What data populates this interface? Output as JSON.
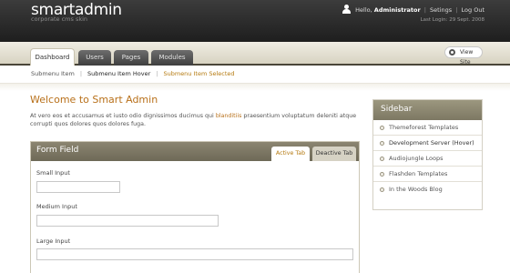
{
  "header": {
    "logo_bold": "smart",
    "logo_light": "admin",
    "tagline": "corporate cms skin",
    "greeting": "Hello,",
    "username": "Administrator",
    "settings": "Setings",
    "logout": "Log Out",
    "last_login": "Last Login: 29 Sept. 2008"
  },
  "nav": {
    "tabs": [
      "Dashboard",
      "Users",
      "Pages",
      "Modules"
    ],
    "view_site": "View Site"
  },
  "submenu": {
    "items": [
      "Submenu Item",
      "Submenu Item Hover",
      "Submenu Item Selected"
    ]
  },
  "main": {
    "welcome": "Welcome to Smart Admin",
    "intro_before": "At vero eos et accusamus et iusto odio dignissimos ducimus qui ",
    "intro_highlight": "blanditiis",
    "intro_after": " praesentium voluptatum deleniti atque corrupti quos dolores quos dolores fuga."
  },
  "form": {
    "title": "Form Field",
    "tab_active": "Active Tab",
    "tab_inactive": "Deactive Tab",
    "fields": [
      {
        "label": "Small Input",
        "value": ""
      },
      {
        "label": "Medium Input",
        "value": ""
      },
      {
        "label": "Large Input",
        "value": ""
      }
    ]
  },
  "sidebar": {
    "title": "Sidebar",
    "items": [
      "Themeforest Templates",
      "Development Server (Hover)",
      "Audiojungle Loops",
      "Flashden Templates",
      "In the Woods Blog"
    ]
  },
  "colors": {
    "accent": "#b8701a",
    "header_bg": "#2a2a2a",
    "panel_head": "#7d7863"
  }
}
